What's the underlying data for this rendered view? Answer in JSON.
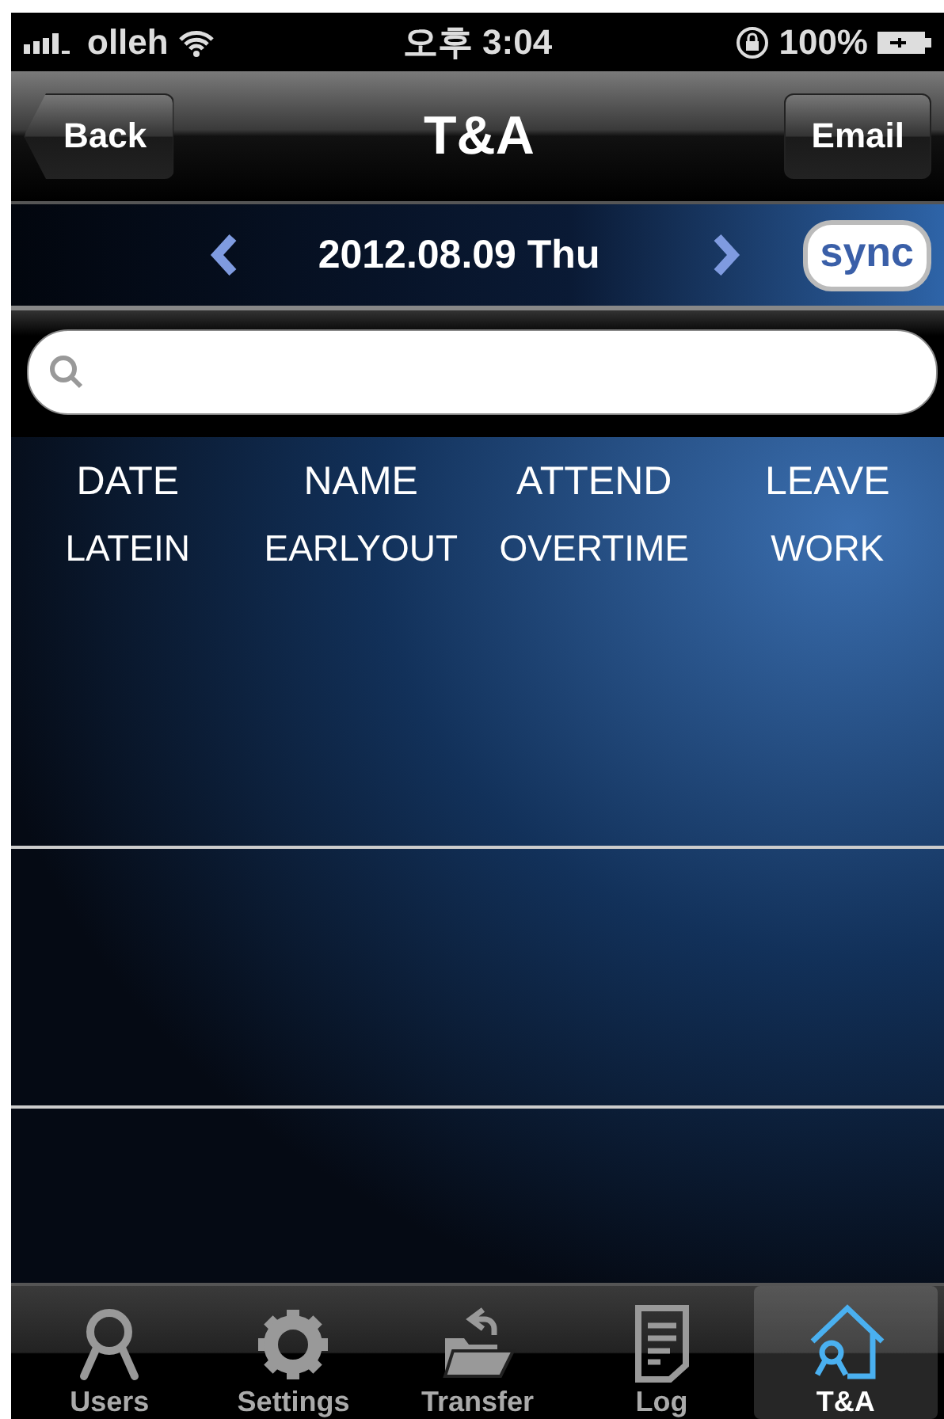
{
  "status_bar": {
    "carrier": "olleh",
    "time": "오후 3:04",
    "battery": "100%"
  },
  "nav_bar": {
    "back": "Back",
    "title": "T&A",
    "action": "Email"
  },
  "date_bar": {
    "date": "2012.08.09 Thu",
    "sync": "sync"
  },
  "columns": [
    [
      "DATE",
      "NAME",
      "ATTEND",
      "LEAVE"
    ],
    [
      "LATEIN",
      "EARLYOUT",
      "OVERTIME",
      "WORK"
    ]
  ],
  "tabs": [
    {
      "label": "Users",
      "selected": false
    },
    {
      "label": "Settings",
      "selected": false
    },
    {
      "label": "Transfer",
      "selected": false
    },
    {
      "label": "Log",
      "selected": false
    },
    {
      "label": "T&A",
      "selected": true
    }
  ]
}
